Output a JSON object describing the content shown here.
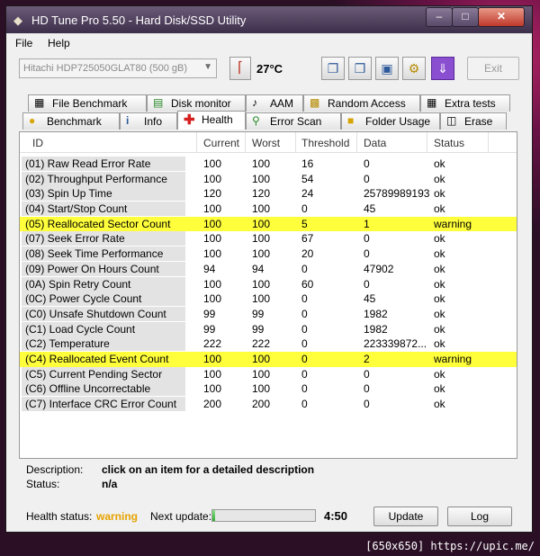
{
  "window": {
    "title": "HD Tune Pro 5.50 - Hard Disk/SSD Utility"
  },
  "menu": {
    "items": [
      "File",
      "Help"
    ]
  },
  "toolbar": {
    "drive": "Hitachi HDP725050GLAT80 (500 gB)",
    "temperature": "27°C",
    "exit_label": "Exit"
  },
  "tabs": {
    "row1": [
      "File Benchmark",
      "Disk monitor",
      "AAM",
      "Random Access",
      "Extra tests"
    ],
    "row2": [
      "Benchmark",
      "Info",
      "Health",
      "Error Scan",
      "Folder Usage",
      "Erase"
    ],
    "active": "Health"
  },
  "table": {
    "headers": [
      "ID",
      "Current",
      "Worst",
      "Threshold",
      "Data",
      "Status"
    ],
    "rows": [
      {
        "id": "(01) Raw Read Error Rate",
        "current": "100",
        "worst": "100",
        "threshold": "16",
        "data": "0",
        "status": "ok"
      },
      {
        "id": "(02) Throughput Performance",
        "current": "100",
        "worst": "100",
        "threshold": "54",
        "data": "0",
        "status": "ok"
      },
      {
        "id": "(03) Spin Up Time",
        "current": "120",
        "worst": "120",
        "threshold": "24",
        "data": "25789989193",
        "status": "ok"
      },
      {
        "id": "(04) Start/Stop Count",
        "current": "100",
        "worst": "100",
        "threshold": "0",
        "data": "45",
        "status": "ok"
      },
      {
        "id": "(05) Reallocated Sector Count",
        "current": "100",
        "worst": "100",
        "threshold": "5",
        "data": "1",
        "status": "warning"
      },
      {
        "id": "(07) Seek Error Rate",
        "current": "100",
        "worst": "100",
        "threshold": "67",
        "data": "0",
        "status": "ok"
      },
      {
        "id": "(08) Seek Time Performance",
        "current": "100",
        "worst": "100",
        "threshold": "20",
        "data": "0",
        "status": "ok"
      },
      {
        "id": "(09) Power On Hours Count",
        "current": "94",
        "worst": "94",
        "threshold": "0",
        "data": "47902",
        "status": "ok"
      },
      {
        "id": "(0A) Spin Retry Count",
        "current": "100",
        "worst": "100",
        "threshold": "60",
        "data": "0",
        "status": "ok"
      },
      {
        "id": "(0C) Power Cycle Count",
        "current": "100",
        "worst": "100",
        "threshold": "0",
        "data": "45",
        "status": "ok"
      },
      {
        "id": "(C0) Unsafe Shutdown Count",
        "current": "99",
        "worst": "99",
        "threshold": "0",
        "data": "1982",
        "status": "ok"
      },
      {
        "id": "(C1) Load Cycle Count",
        "current": "99",
        "worst": "99",
        "threshold": "0",
        "data": "1982",
        "status": "ok"
      },
      {
        "id": "(C2) Temperature",
        "current": "222",
        "worst": "222",
        "threshold": "0",
        "data": "223339872...",
        "status": "ok"
      },
      {
        "id": "(C4) Reallocated Event Count",
        "current": "100",
        "worst": "100",
        "threshold": "0",
        "data": "2",
        "status": "warning"
      },
      {
        "id": "(C5) Current Pending Sector",
        "current": "100",
        "worst": "100",
        "threshold": "0",
        "data": "0",
        "status": "ok"
      },
      {
        "id": "(C6) Offline Uncorrectable",
        "current": "100",
        "worst": "100",
        "threshold": "0",
        "data": "0",
        "status": "ok"
      },
      {
        "id": "(C7) Interface CRC Error Count",
        "current": "200",
        "worst": "200",
        "threshold": "0",
        "data": "0",
        "status": "ok"
      }
    ]
  },
  "description": {
    "label": "Description:",
    "value": "click on an item for a detailed description",
    "status_label": "Status:",
    "status_value": "n/a"
  },
  "statusbar": {
    "health_label": "Health status:",
    "health_value": "warning",
    "next_update_label": "Next update:",
    "progress": 0.03,
    "time": "4:50",
    "update_label": "Update",
    "log_label": "Log"
  },
  "footer": {
    "text": "[650x650] https://upic.me/"
  },
  "colors": {
    "warning_row": "#ffff3c",
    "warning_text": "#e6a200",
    "title_bar": "#4a3d58"
  }
}
